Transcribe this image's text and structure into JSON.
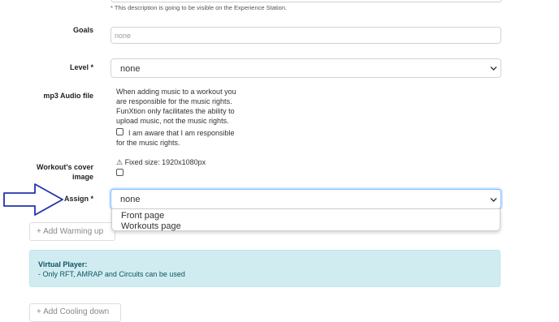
{
  "description_note": "* This description is going to be visible on the Experience Station.",
  "goals": {
    "label": "Goals",
    "placeholder": "none"
  },
  "level": {
    "label": "Level *",
    "value": "none"
  },
  "audio": {
    "label": "mp3 Audio file",
    "notice_lines": [
      "When adding music to a workout you",
      "are responsible for the music rights.",
      "FunXtion only facilitates the ability to",
      "upload music, not the music rights."
    ],
    "checkbox_line1": "I am aware that I am responsible",
    "checkbox_line2": "for the music rights."
  },
  "cover": {
    "label_line1": "Workout's cover",
    "label_line2": "image",
    "size_note": "⚠ Fixed size: 1920x1080px"
  },
  "assign": {
    "label": "Assign *",
    "value": "none",
    "options": [
      "Front page",
      "Workouts page"
    ]
  },
  "buttons": {
    "warming_up": "+ Add Warming up",
    "cooling_down": "+ Add Cooling down"
  },
  "virtual_player": {
    "title": "Virtual Player:",
    "text": "- Only RFT, AMRAP and Circuits can be used"
  },
  "annotation": {
    "arrow_color": "#2233aa"
  }
}
